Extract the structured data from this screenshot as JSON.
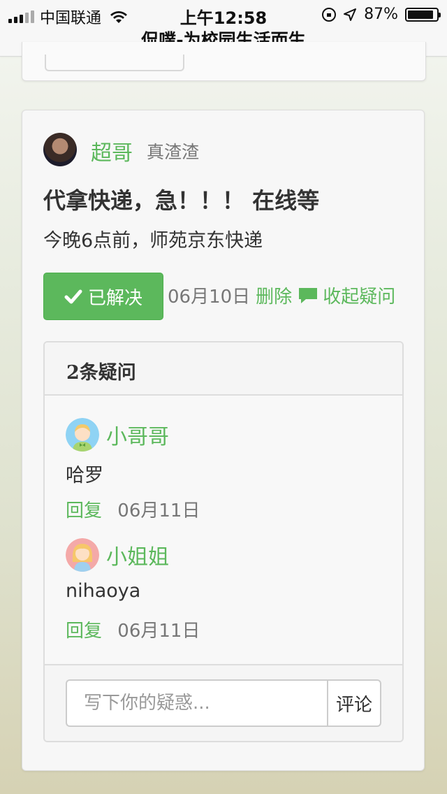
{
  "status_bar": {
    "carrier": "中国联通",
    "time": "上午12:58",
    "battery": "87%",
    "battery_level": 0.87
  },
  "page": {
    "title": "侃噗-为校园生活而生"
  },
  "post": {
    "author": "超哥",
    "signature": "真渣渣",
    "title": "代拿快递，急！！！ 在线等",
    "body": "今晚6点前，师苑京东快递",
    "status_label": "已解决",
    "date": "06月10日",
    "delete_label": "删除",
    "collapse_label": "收起疑问",
    "colors": {
      "accent": "#5cb85c",
      "muted": "#777777"
    }
  },
  "questions": {
    "heading": "2条疑问",
    "items": [
      {
        "name": "小哥哥",
        "text": "哈罗",
        "reply_label": "回复",
        "date": "06月11日",
        "avatar": "boy-avatar-icon"
      },
      {
        "name": "小姐姐",
        "text": "nihaoya",
        "reply_label": "回复",
        "date": "06月11日",
        "avatar": "girl-avatar-icon"
      }
    ],
    "input_placeholder": "写下你的疑惑...",
    "submit_label": "评论"
  }
}
